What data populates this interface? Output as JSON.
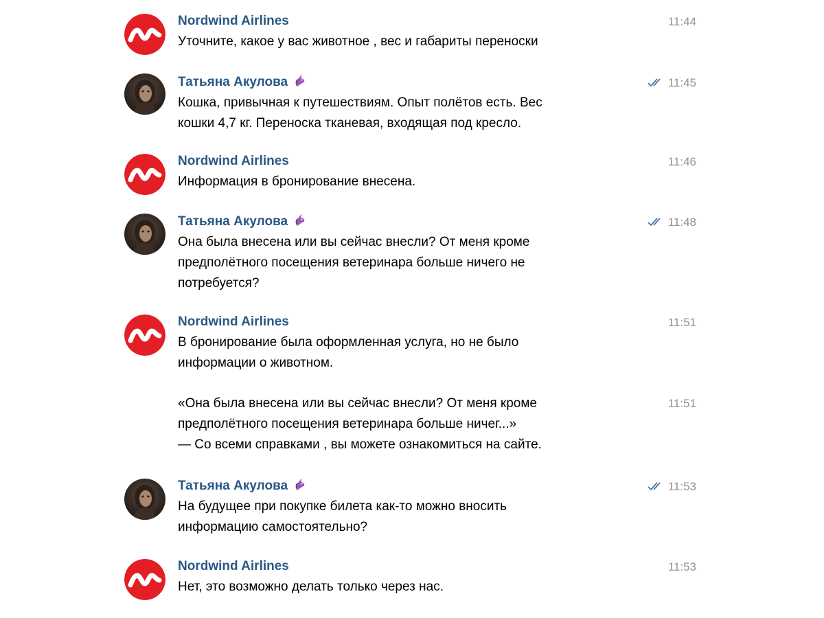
{
  "colors": {
    "sender_name": "#2a5885",
    "timestamp": "#939393",
    "read_check": "#4a76a8",
    "nordwind_red": "#e31e24"
  },
  "messages": [
    {
      "sender": "Nordwind Airlines",
      "avatar": "nordwind-logo-icon",
      "time": "11:44",
      "lines": [
        "Уточните, какое у вас животное , вес и габариты переноски"
      ]
    },
    {
      "sender": "Татьяна Акулова",
      "avatar": "user-photo",
      "emoji": "unicorn-emoji-icon",
      "read": true,
      "time": "11:45",
      "lines": [
        "Кошка, привычная к путешествиям. Опыт полётов есть. Вес",
        "кошки 4,7 кг. Переноска тканевая, входящая под кресло."
      ]
    },
    {
      "sender": "Nordwind Airlines",
      "avatar": "nordwind-logo-icon",
      "time": "11:46",
      "lines": [
        "Информация в бронирование внесена."
      ]
    },
    {
      "sender": "Татьяна Акулова",
      "avatar": "user-photo",
      "emoji": "unicorn-emoji-icon",
      "read": true,
      "time": "11:48",
      "lines": [
        "Она была внесена или вы сейчас внесли? От меня кроме",
        "предполётного посещения ветеринара больше ничего не",
        "потребуется?"
      ]
    },
    {
      "sender": "Nordwind Airlines",
      "avatar": "nordwind-logo-icon",
      "time": "11:51",
      "lines": [
        "В бронирование была оформленная услуга, но не было",
        "информации о животном."
      ]
    },
    {
      "sender": "",
      "time": "11:51",
      "lines": [
        "«Она была внесена или вы сейчас внесли? От меня кроме",
        "предполётного посещения ветеринара больше ничег...»",
        "— Со всеми справками , вы можете ознакомиться на сайте."
      ]
    },
    {
      "sender": "Татьяна Акулова",
      "avatar": "user-photo",
      "emoji": "unicorn-emoji-icon",
      "read": true,
      "time": "11:53",
      "lines": [
        "На будущее при покупке билета как-то можно вносить",
        "информацию самостоятельно?"
      ]
    },
    {
      "sender": "Nordwind Airlines",
      "avatar": "nordwind-logo-icon",
      "time": "11:53",
      "lines": [
        "Нет, это возможно делать только через нас."
      ]
    }
  ]
}
